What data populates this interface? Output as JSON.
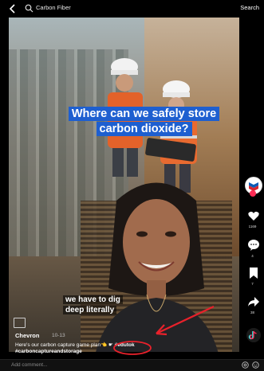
{
  "search": {
    "query": "Carbon Fiber",
    "button_label": "Search"
  },
  "video": {
    "caption_top": "Where can we safely store carbon dioxide?",
    "caption_bottom": "we have to dig deep literally"
  },
  "rail": {
    "likes": "1169",
    "comments": "4",
    "saves": "7",
    "shares": "38"
  },
  "post": {
    "author": "Chevron",
    "date": "10-13",
    "description": "Here's our carbon capture game plan👈 ☛",
    "description_tag": "#edutok",
    "tags": "#carboncaptureandstorage"
  },
  "comment": {
    "placeholder": "Add comment..."
  },
  "colors": {
    "caption_bg": "#1e5fd0",
    "annotation": "#e8212b",
    "like_accent": "#fe2c55"
  }
}
